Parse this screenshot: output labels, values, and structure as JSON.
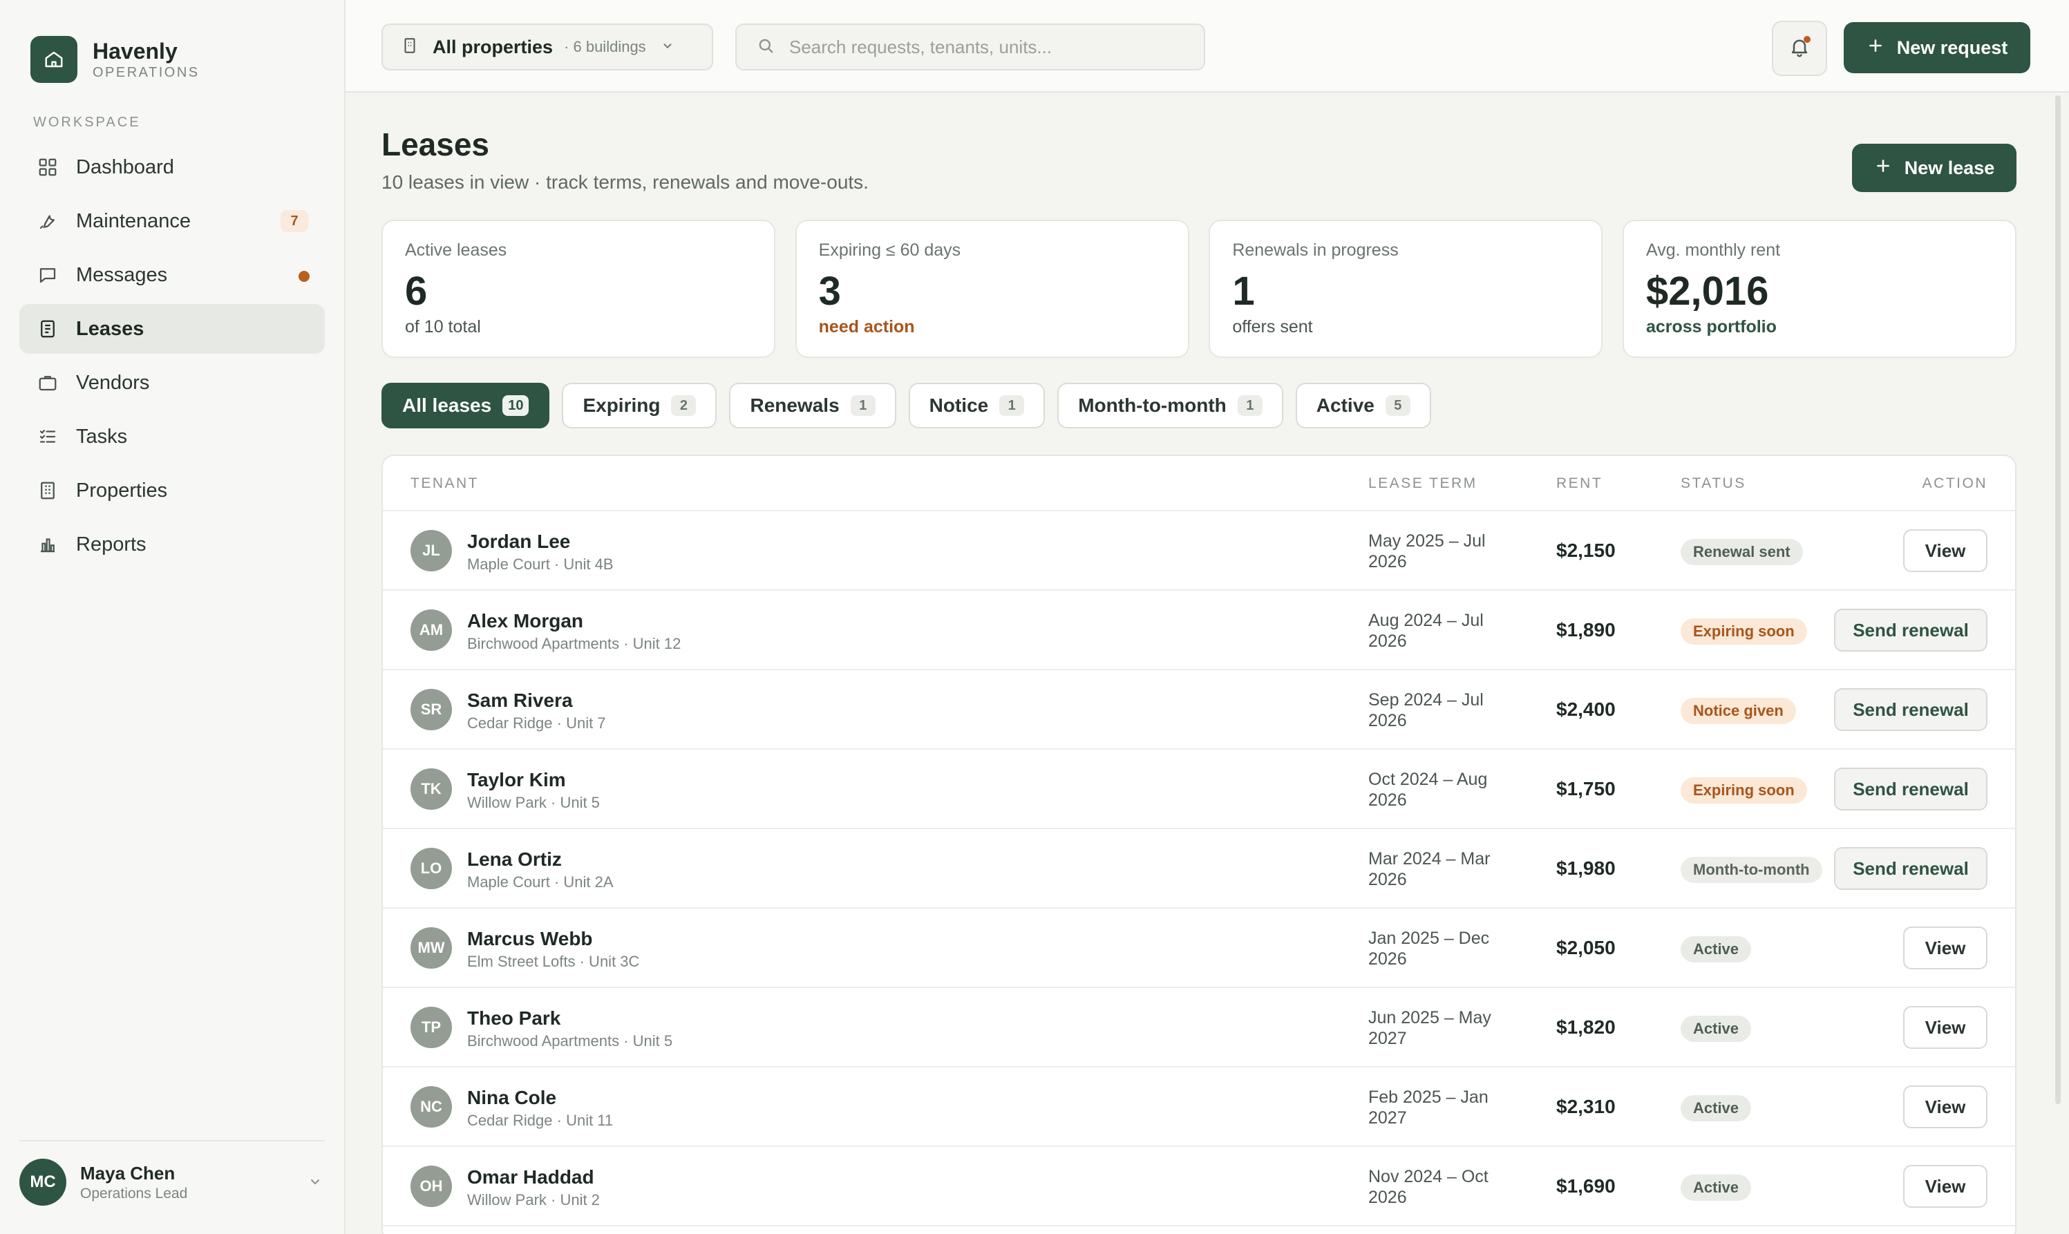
{
  "brand": {
    "name": "Havenly",
    "sub": "OPERATIONS"
  },
  "sidebar": {
    "section_label": "WORKSPACE",
    "items": [
      {
        "label": "Dashboard",
        "icon": "grid-icon"
      },
      {
        "label": "Maintenance",
        "icon": "wrench-icon",
        "badge": "7"
      },
      {
        "label": "Messages",
        "icon": "chat-icon",
        "dot": true
      },
      {
        "label": "Leases",
        "icon": "document-icon",
        "active": true
      },
      {
        "label": "Vendors",
        "icon": "briefcase-icon"
      },
      {
        "label": "Tasks",
        "icon": "checklist-icon"
      },
      {
        "label": "Properties",
        "icon": "building-icon"
      },
      {
        "label": "Reports",
        "icon": "bar-chart-icon"
      }
    ]
  },
  "user": {
    "initials": "MC",
    "name": "Maya Chen",
    "role": "Operations Lead"
  },
  "topbar": {
    "property_label": "All properties",
    "property_count": "· 6 buildings",
    "search_placeholder": "Search requests, tenants, units...",
    "new_request_label": "New request"
  },
  "page": {
    "title": "Leases",
    "subtitle": "10 leases in view · track terms, renewals and move-outs.",
    "new_lease_label": "New lease"
  },
  "stats": [
    {
      "label": "Active leases",
      "value": "6",
      "sub": "of 10 total",
      "tone": "neutral"
    },
    {
      "label": "Expiring ≤ 60 days",
      "value": "3",
      "sub": "need action",
      "tone": "warn"
    },
    {
      "label": "Renewals in progress",
      "value": "1",
      "sub": "offers sent",
      "tone": "neutral"
    },
    {
      "label": "Avg. monthly rent",
      "value": "$2,016",
      "sub": "across portfolio",
      "tone": "green"
    }
  ],
  "filters": [
    {
      "label": "All leases",
      "count": "10",
      "active": true
    },
    {
      "label": "Expiring",
      "count": "2"
    },
    {
      "label": "Renewals",
      "count": "1"
    },
    {
      "label": "Notice",
      "count": "1"
    },
    {
      "label": "Month-to-month",
      "count": "1"
    },
    {
      "label": "Active",
      "count": "5"
    }
  ],
  "table": {
    "headers": {
      "tenant": "TENANT",
      "term": "LEASE TERM",
      "rent": "RENT",
      "status": "STATUS",
      "action": "ACTION"
    },
    "rows": [
      {
        "initials": "JL",
        "name": "Jordan Lee",
        "unit": "Maple Court · Unit 4B",
        "term_line1": "May 2025 – Jul",
        "term_line2": "2026",
        "rent": "$2,150",
        "status": "Renewal sent",
        "tone": "green",
        "action": "View"
      },
      {
        "initials": "AM",
        "name": "Alex Morgan",
        "unit": "Birchwood Apartments · Unit 12",
        "term_line1": "Aug 2024 – Jul",
        "term_line2": "2026",
        "rent": "$1,890",
        "status": "Expiring soon",
        "tone": "orange",
        "action": "Send renewal"
      },
      {
        "initials": "SR",
        "name": "Sam Rivera",
        "unit": "Cedar Ridge · Unit 7",
        "term_line1": "Sep 2024 – Jul",
        "term_line2": "2026",
        "rent": "$2,400",
        "status": "Notice given",
        "tone": "orange",
        "action": "Send renewal"
      },
      {
        "initials": "TK",
        "name": "Taylor Kim",
        "unit": "Willow Park · Unit 5",
        "term_line1": "Oct 2024 – Aug",
        "term_line2": "2026",
        "rent": "$1,750",
        "status": "Expiring soon",
        "tone": "orange",
        "action": "Send renewal"
      },
      {
        "initials": "LO",
        "name": "Lena Ortiz",
        "unit": "Maple Court · Unit 2A",
        "term_line1": "Mar 2024 – Mar",
        "term_line2": "2026",
        "rent": "$1,980",
        "status": "Month-to-month",
        "tone": "gray",
        "action": "Send renewal"
      },
      {
        "initials": "MW",
        "name": "Marcus Webb",
        "unit": "Elm Street Lofts · Unit 3C",
        "term_line1": "Jan 2025 – Dec",
        "term_line2": "2026",
        "rent": "$2,050",
        "status": "Active",
        "tone": "green",
        "action": "View"
      },
      {
        "initials": "TP",
        "name": "Theo Park",
        "unit": "Birchwood Apartments · Unit 5",
        "term_line1": "Jun 2025 – May",
        "term_line2": "2027",
        "rent": "$1,820",
        "status": "Active",
        "tone": "green",
        "action": "View"
      },
      {
        "initials": "NC",
        "name": "Nina Cole",
        "unit": "Cedar Ridge · Unit 11",
        "term_line1": "Feb 2025 – Jan",
        "term_line2": "2027",
        "rent": "$2,310",
        "status": "Active",
        "tone": "green",
        "action": "View"
      },
      {
        "initials": "OH",
        "name": "Omar Haddad",
        "unit": "Willow Park · Unit 2",
        "term_line1": "Nov 2024 – Oct",
        "term_line2": "2026",
        "rent": "$1,690",
        "status": "Active",
        "tone": "green",
        "action": "View"
      }
    ]
  },
  "colors": {
    "accent": "#2e5443",
    "warn": "#a8551b",
    "background": "#f4f4f1"
  }
}
